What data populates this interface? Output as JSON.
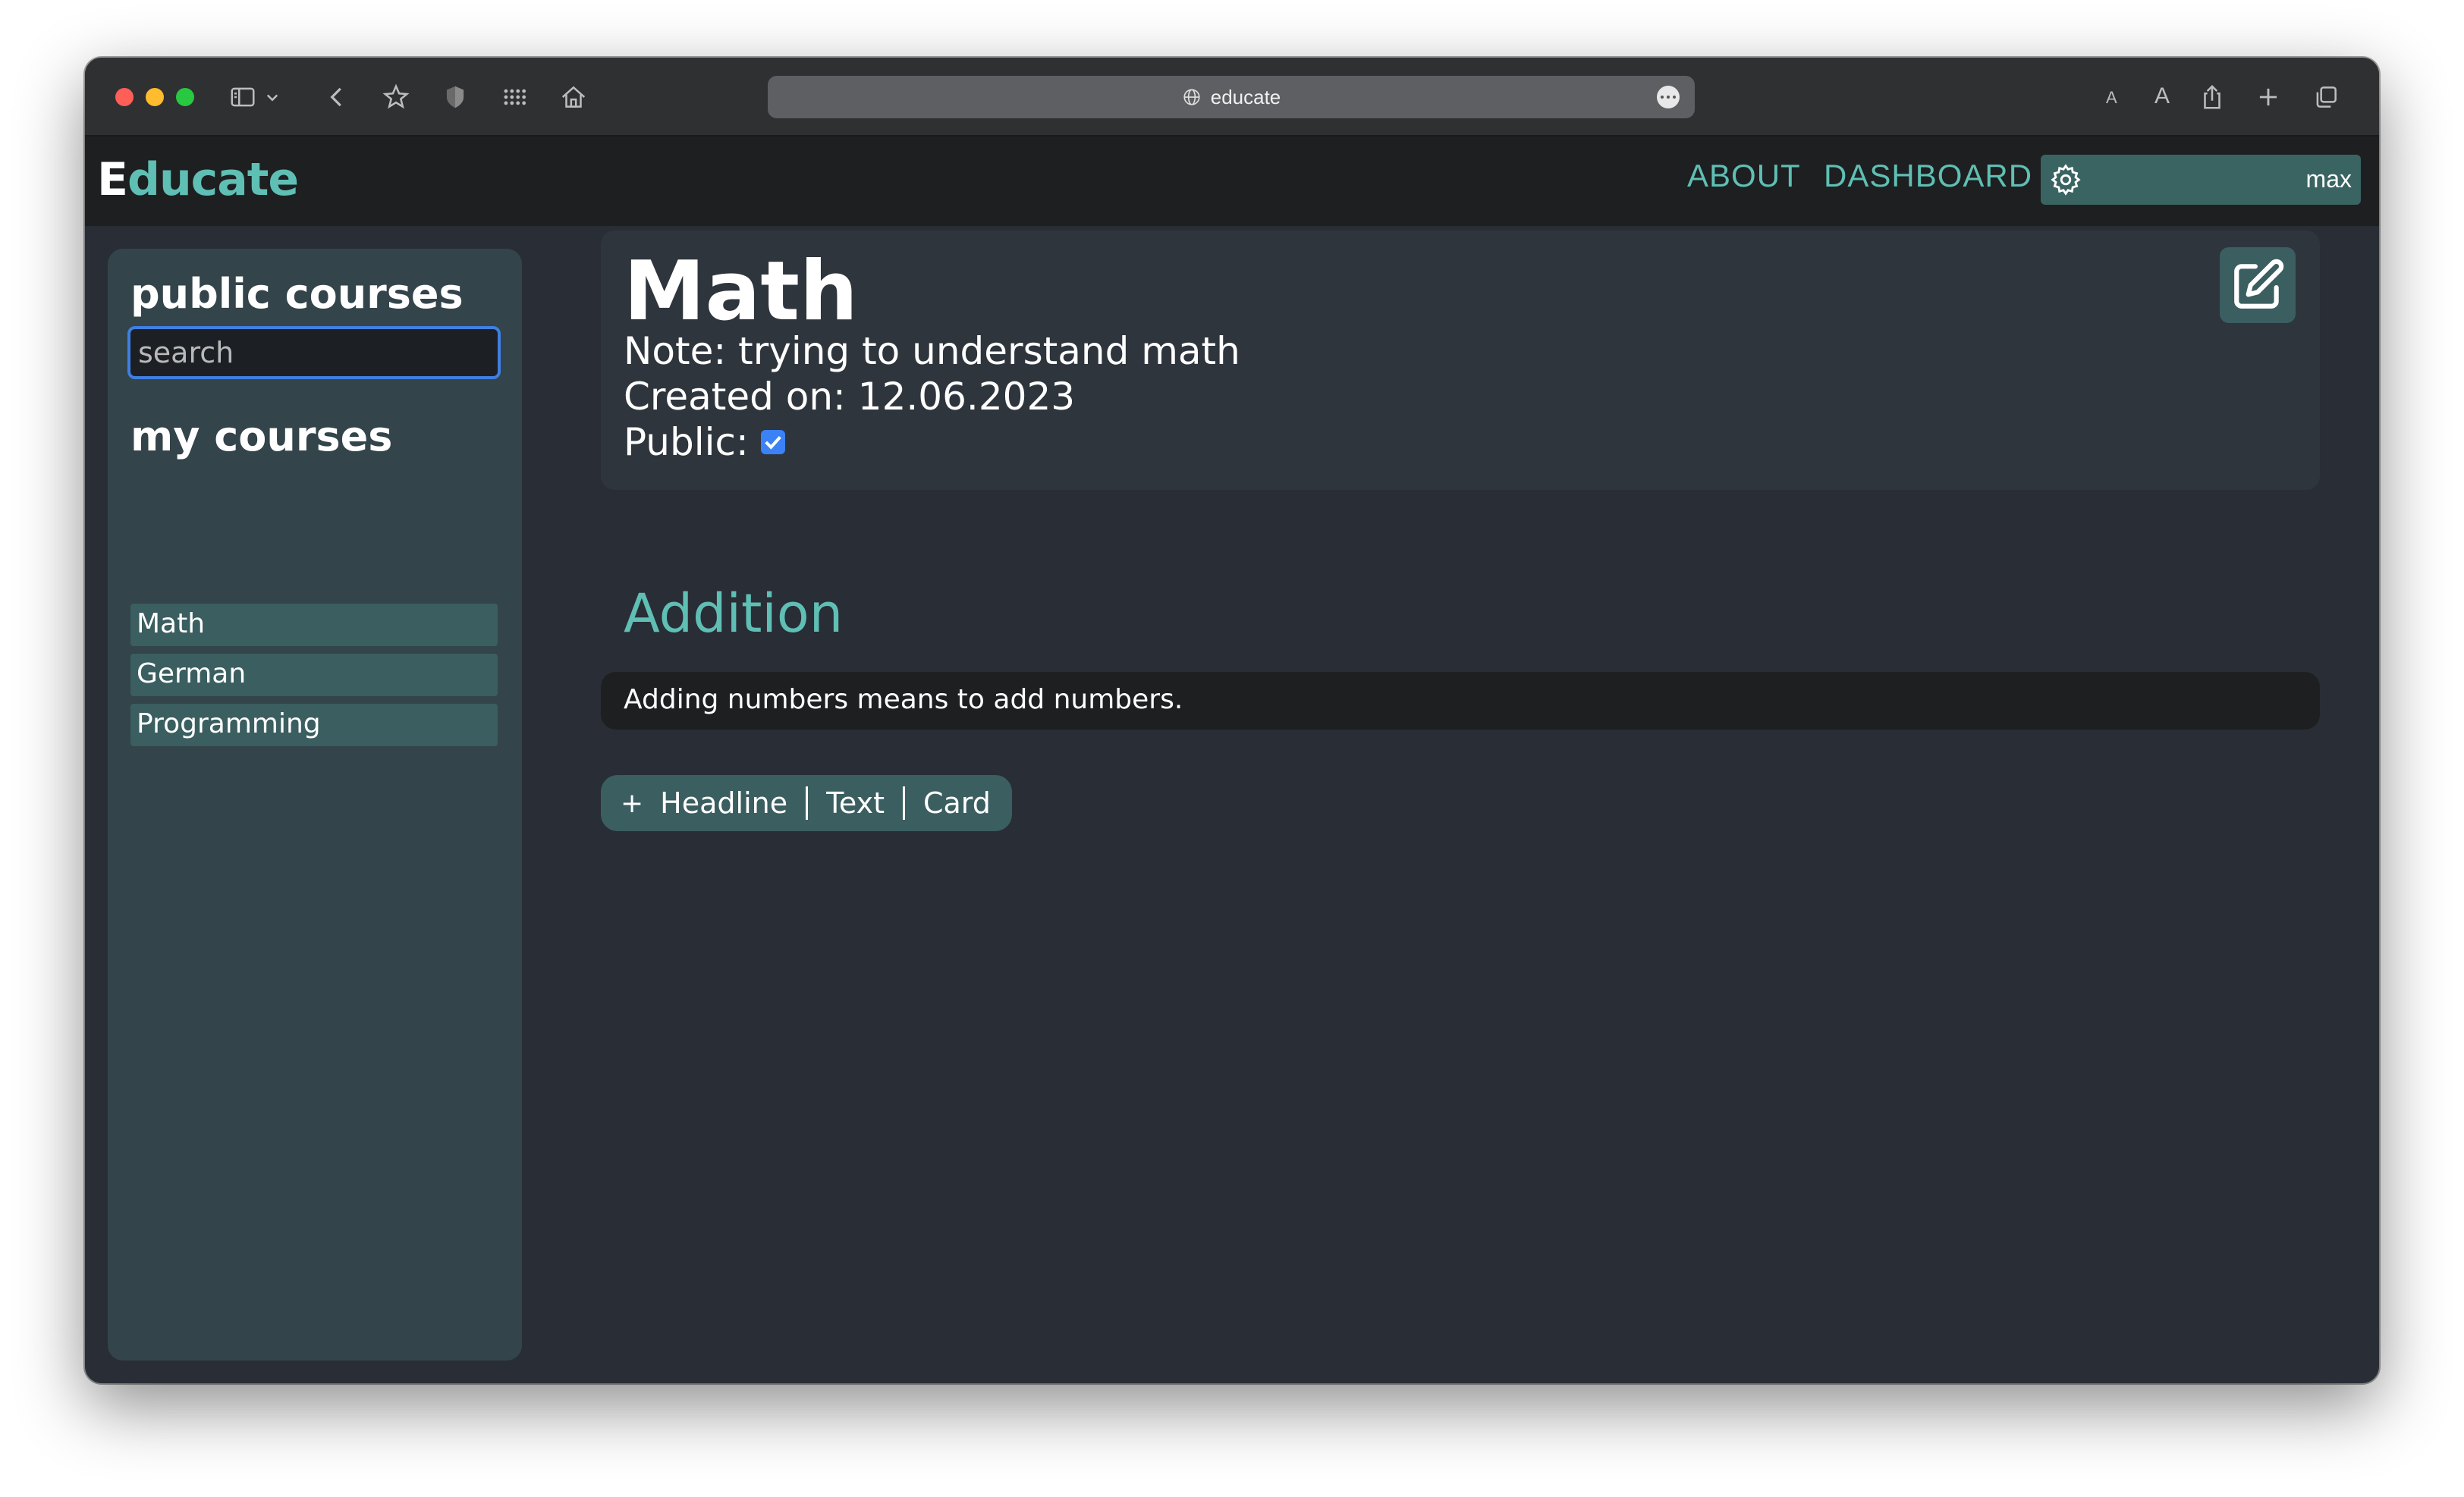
{
  "browser": {
    "url": "educate"
  },
  "app": {
    "logo_first": "E",
    "logo_rest": "ducate",
    "nav": {
      "about": "ABOUT",
      "dashboard": "DASHBOARD"
    },
    "user": {
      "name": "max"
    }
  },
  "sidebar": {
    "public_heading": "public courses",
    "search_placeholder": "search",
    "my_heading": "my courses",
    "courses": [
      {
        "label": "Math"
      },
      {
        "label": "German"
      },
      {
        "label": "Programming"
      }
    ]
  },
  "course": {
    "title": "Math",
    "note": "Note: trying to understand math",
    "created": "Created on: 12.06.2023",
    "public_label": "Public:",
    "public": true
  },
  "content": {
    "headline": "Addition",
    "text": "Adding numbers means to add numbers."
  },
  "add_toolbar": {
    "plus": "+",
    "headline": "Headline",
    "text": "Text",
    "card": "Card"
  },
  "colors": {
    "accent": "#5fbfb4",
    "panel": "#33444a",
    "button": "#3b5e60",
    "background": "#292d36"
  }
}
